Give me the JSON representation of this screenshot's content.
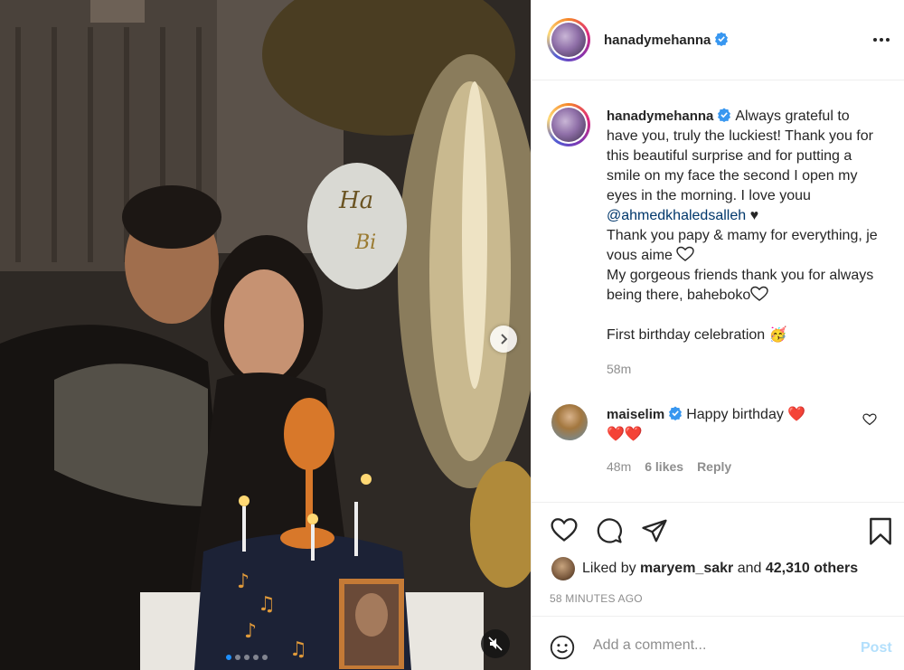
{
  "post": {
    "author": "hanadymehanna",
    "caption": {
      "line1": "Always grateful to have you, truly the luckiest! Thank you for this beautiful surprise and for putting a smile on my face the second I open my eyes in the morning. I love youu ",
      "mention": "@ahmedkhaledsalleh",
      "heart1": " ♥",
      "line2": "Thank you papy & mamy for everything, je vous aime ",
      "line3": "My gorgeous friends thank you for always being there, baheboko",
      "line4": "First birthday celebration ",
      "emoji": "🥳"
    },
    "time": "58m"
  },
  "comment": {
    "author": "maiselim",
    "text": "Happy birthday ",
    "hearts": "❤️",
    "hearts_line2": "❤️❤️",
    "time": "48m",
    "likes": "6 likes",
    "reply": "Reply"
  },
  "likes": {
    "prefix": "Liked by ",
    "user": "maryem_sakr",
    "middle": " and ",
    "count": "42,310 others"
  },
  "timestamp": "58 MINUTES AGO",
  "add_comment": {
    "placeholder": "Add a comment...",
    "post_label": "Post"
  },
  "carousel": {
    "slide_count": 5,
    "active_slide": 1
  },
  "colors": {
    "link": "#00376b",
    "verified": "#3897f0",
    "post_disabled": "#b2dffc",
    "active_dot": "#1e90ff"
  }
}
